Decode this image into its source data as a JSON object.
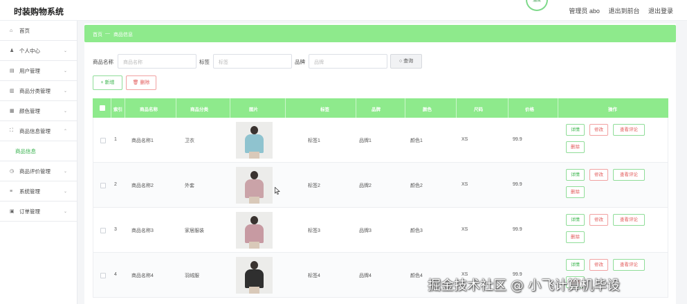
{
  "app": {
    "title": "时装购物系统",
    "weather_badge": "温度"
  },
  "topnav": {
    "admin_label": "管理员 abo",
    "back_frontend": "退出到前台",
    "logout": "退出登录"
  },
  "sidebar": {
    "items": [
      {
        "label": "首页",
        "icon": "home-icon"
      },
      {
        "label": "个人中心",
        "icon": "user-icon"
      },
      {
        "label": "用户管理",
        "icon": "users-icon"
      },
      {
        "label": "商品分类管理",
        "icon": "category-icon"
      },
      {
        "label": "颜色管理",
        "icon": "color-icon"
      },
      {
        "label": "商品信息管理",
        "icon": "goods-icon",
        "expanded": true
      },
      {
        "label": "商品评价管理",
        "icon": "review-icon"
      },
      {
        "label": "系统管理",
        "icon": "system-icon"
      },
      {
        "label": "订单管理",
        "icon": "order-icon"
      }
    ],
    "sub_active": "商品信息"
  },
  "breadcrumb": {
    "home": "首页",
    "sep": "—",
    "current": "商品信息"
  },
  "search": {
    "name_label": "商品名称",
    "name_placeholder": "商品名称",
    "tag_label": "标签",
    "tag_placeholder": "标签",
    "brand_label": "品牌",
    "brand_placeholder": "品牌",
    "query_button": "查询"
  },
  "actions": {
    "add": "新增",
    "delete": "删除"
  },
  "table": {
    "headers": [
      "索引",
      "商品名称",
      "商品分类",
      "图片",
      "标签",
      "品牌",
      "颜色",
      "尺码",
      "价格",
      "操作"
    ],
    "rows": [
      {
        "index": "1",
        "name": "商品名称1",
        "category": "卫衣",
        "tag": "标签1",
        "brand": "品牌1",
        "color": "颜色1",
        "size": "XS",
        "price": "99.9",
        "body_color": "#8fc3cf"
      },
      {
        "index": "2",
        "name": "商品名称2",
        "category": "外套",
        "tag": "标签2",
        "brand": "品牌2",
        "color": "颜色2",
        "size": "XS",
        "price": "99.9",
        "body_color": "#caa3a8"
      },
      {
        "index": "3",
        "name": "商品名称3",
        "category": "家居服装",
        "tag": "标签3",
        "brand": "品牌3",
        "color": "颜色3",
        "size": "XS",
        "price": "99.9",
        "body_color": "#c79aa2"
      },
      {
        "index": "4",
        "name": "商品名称4",
        "category": "羽绒服",
        "tag": "标签4",
        "brand": "品牌4",
        "color": "颜色4",
        "size": "XS",
        "price": "99.9",
        "body_color": "#2f2f2f"
      }
    ],
    "row_actions": {
      "detail": "详情",
      "edit": "修改",
      "review": "查看评论",
      "delete": "删除"
    }
  },
  "watermark": "掘金技术社区 @ 小飞计算机毕设",
  "colors": {
    "accent": "#8eea8c",
    "green_text": "#3bb54d",
    "red_text": "#e25b5b"
  }
}
